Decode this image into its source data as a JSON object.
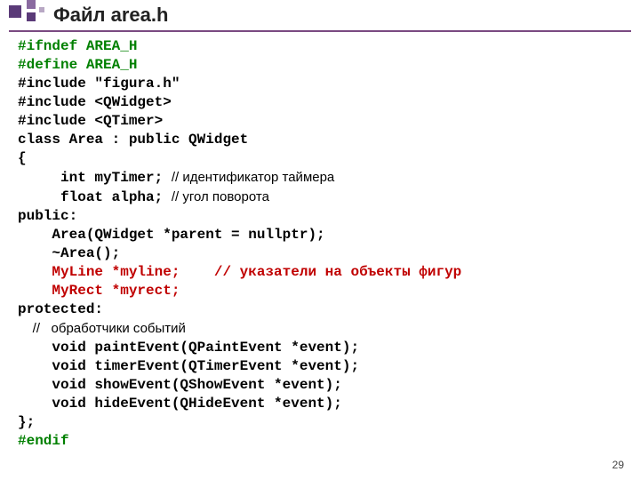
{
  "title": "Файл area.h",
  "code": {
    "l1": "#ifndef AREA_H",
    "l2": "#define AREA_H",
    "l3": "#include \"figura.h\"",
    "l4": "#include <QWidget>",
    "l5": "#include <QTimer>",
    "l6": "class Area : public QWidget",
    "l7": "{",
    "l8a": "     int myTimer; ",
    "l8b": "// идентификатор таймера",
    "l9a": "     float alpha; ",
    "l9b": "// угол поворота",
    "l10": "public:",
    "l11": "    Area(QWidget *parent = nullptr);",
    "l12": "    ~Area();",
    "l13": "    MyLine *myline;    // указатели на объекты фигур",
    "l14": "    MyRect *myrect;",
    "l15": "protected:",
    "l16": "    //   обработчики событий",
    "l17": "    void paintEvent(QPaintEvent *event);",
    "l18": "    void timerEvent(QTimerEvent *event);",
    "l19": "    void showEvent(QShowEvent *event);",
    "l20": "    void hideEvent(QHideEvent *event);",
    "l21": "};",
    "l22": "#endif"
  },
  "page": "29"
}
